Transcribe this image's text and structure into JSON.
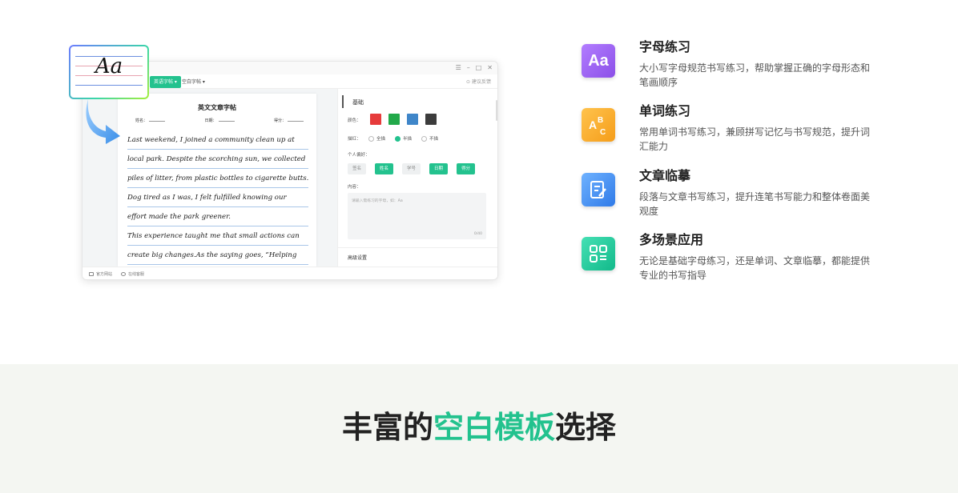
{
  "app": {
    "tabs": {
      "active": "英语字帖 ▾",
      "second": "空白字帖 ▾",
      "feedback": "建议反馈"
    },
    "win_controls": [
      "☰",
      "–",
      "□",
      "✕"
    ],
    "sheet": {
      "title": "英文文章字帖",
      "fields": {
        "name": "姓名：",
        "date": "日期：",
        "score": "得分："
      },
      "lines": [
        "    Last weekend, I joined a community clean up at",
        " local park. Despite the scorching sun, we collected",
        "piles of litter, from plastic bottles to cigarette butts.",
        "Dog tired as I was, I felt fulfilled knowing our",
        "effort made the park greener.",
        "    This experience taught me that small actions can",
        "create big changes.As the saying goes, “Helping"
      ]
    },
    "footer": {
      "official": "官方网站",
      "service": "在线客服"
    },
    "panel": {
      "section": "基础",
      "color_label": "颜色：",
      "colors": [
        "#e63b3b",
        "#22a94a",
        "#3f86c9",
        "#3c3c3c"
      ],
      "trace_label": "描红：",
      "trace_options": [
        {
          "label": "全描",
          "selected": false
        },
        {
          "label": "半描",
          "selected": true
        },
        {
          "label": "不描",
          "selected": false
        }
      ],
      "habit_label": "个人偏好：",
      "habits": [
        {
          "label": "签名",
          "active": false
        },
        {
          "label": "姓名",
          "active": true
        },
        {
          "label": "学号",
          "active": false
        },
        {
          "label": "日期",
          "active": true
        },
        {
          "label": "得分",
          "active": true
        }
      ],
      "content_label": "内容：",
      "content_placeholder": "请输入需练习的字母，如：Aa",
      "counter": "0/40",
      "advanced": "高级设置"
    }
  },
  "aa_card": {
    "text": "Aa"
  },
  "features": [
    {
      "title": "字母练习",
      "desc": "大小写字母规范书写练习，帮助掌握正确的字母形态和笔画顺序",
      "icon": "aa-letter-icon",
      "color": "#9b5cf0"
    },
    {
      "title": "单词练习",
      "desc": "常用单词书写练习，兼顾拼写记忆与书写规范，提升词汇能力",
      "icon": "abc-icon",
      "color": "#f5a524"
    },
    {
      "title": "文章临摹",
      "desc": "段落与文章书写练习，提升连笔书写能力和整体卷面美观度",
      "icon": "document-pen-icon",
      "color": "#3b8cf0"
    },
    {
      "title": "多场景应用",
      "desc": "无论是基础字母练习，还是单词、文章临摹，都能提供专业的书写指导",
      "icon": "grid-list-icon",
      "color": "#1fc79a"
    }
  ],
  "heading": {
    "part1": "丰富的",
    "highlight": "空白模板",
    "part2": "选择"
  }
}
